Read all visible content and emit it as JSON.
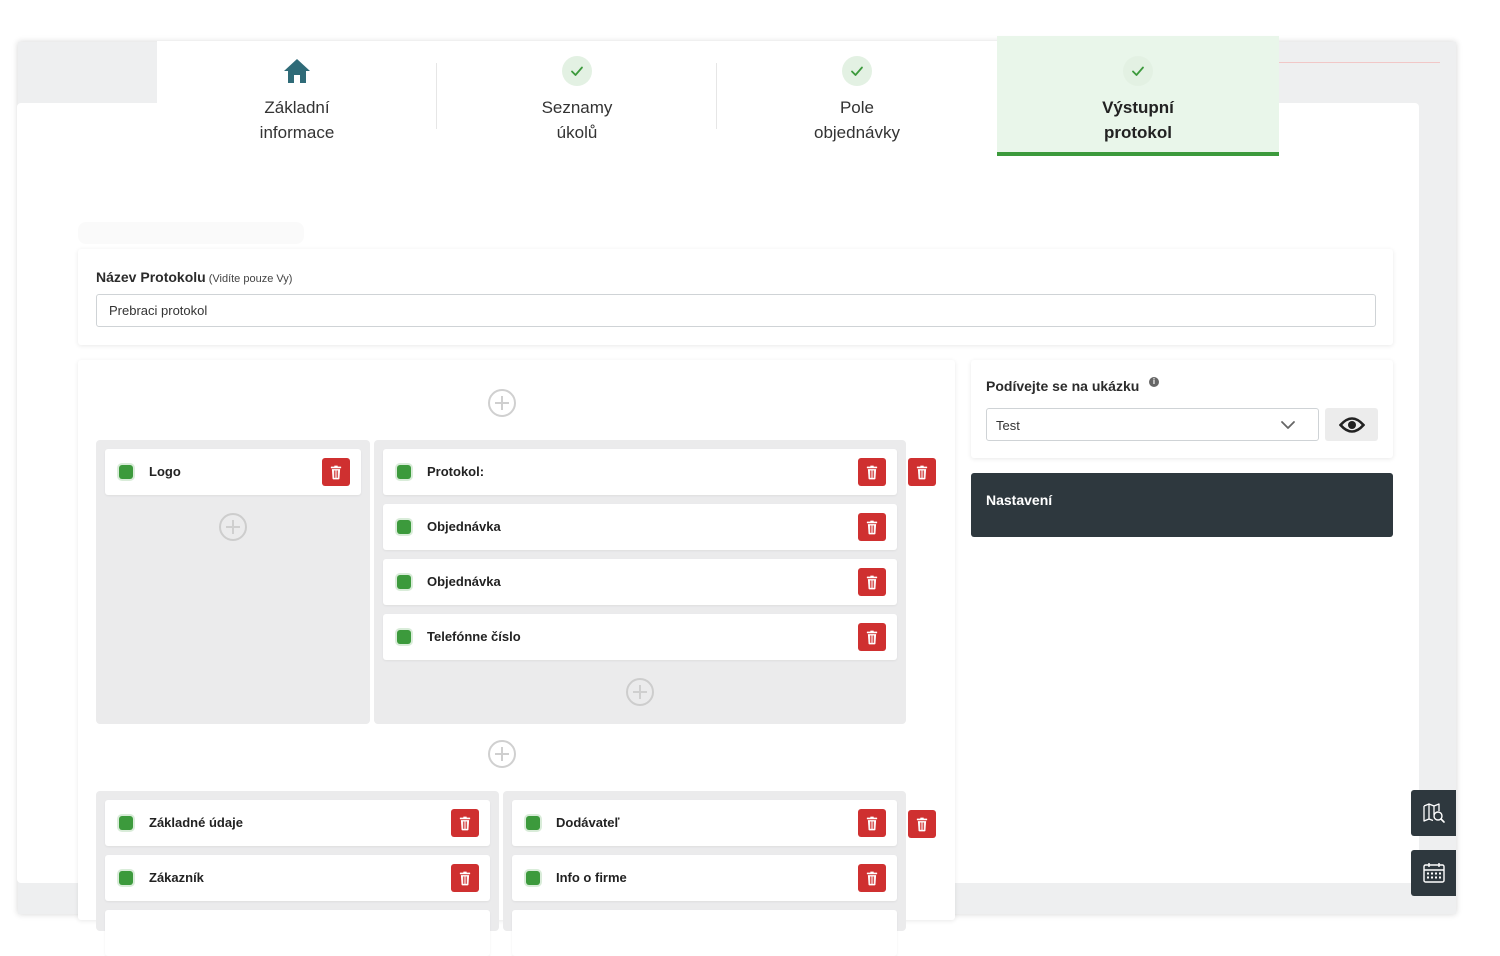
{
  "tabs": [
    {
      "line1": "Základní",
      "line2": "informace",
      "icon": "home-icon"
    },
    {
      "line1": "Seznamy",
      "line2": "úkolů",
      "icon": "check-icon"
    },
    {
      "line1": "Pole",
      "line2": "objednávky",
      "icon": "check-icon"
    },
    {
      "line1": "Výstupní",
      "line2": "protokol",
      "icon": "check-icon"
    }
  ],
  "protocol": {
    "label": "Název Protokolu",
    "hint": "(Vidíte pouze Vy)",
    "value": "Prebraci protokol"
  },
  "rows": [
    {
      "columns": [
        {
          "items": [
            "Logo"
          ]
        },
        {
          "items": [
            "Protokol:",
            "Objednávka",
            "Objednávka",
            "Telefónne číslo"
          ]
        }
      ]
    },
    {
      "columns": [
        {
          "items": [
            "Základné údaje",
            "Zákazník"
          ]
        },
        {
          "items": [
            "Dodávateľ",
            "Info o firme"
          ]
        }
      ]
    }
  ],
  "preview": {
    "title": "Podívejte se na ukázku",
    "selected": "Test"
  },
  "settings": {
    "label": "Nastavení"
  },
  "side_buttons": [
    "map-search-icon",
    "calendar-icon"
  ],
  "colors": {
    "accent_green": "#3c9a3c",
    "active_tab_bg": "#e9f6ea",
    "trash_red": "#cf3030",
    "dark_panel": "#2e383e",
    "home_icon": "#2f6b78"
  }
}
